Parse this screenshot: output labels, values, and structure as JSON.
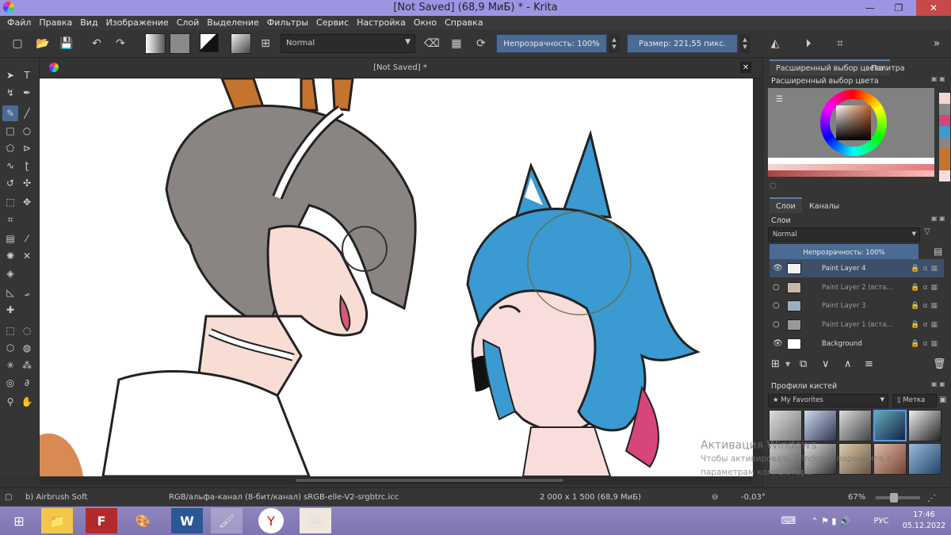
{
  "window": {
    "title": "[Not Saved]  (68,9 МиБ)  * - Krita"
  },
  "menu": [
    "Файл",
    "Правка",
    "Вид",
    "Изображение",
    "Слой",
    "Выделение",
    "Фильтры",
    "Сервис",
    "Настройка",
    "Окно",
    "Справка"
  ],
  "toolbar": {
    "blend_mode": "Normal",
    "opacity_label": "Непрозрачность: 100%",
    "size_label": "Размер: 221,55 пикс."
  },
  "canvas": {
    "tab_title": "[Not Saved]  *"
  },
  "docker": {
    "color_tabs": [
      "Расширенный выбор цвета",
      "Палитра"
    ],
    "color_panel_title": "Расширенный выбор цвета",
    "layer_tabs": [
      "Слои",
      "Каналы"
    ],
    "layers_title": "Слои",
    "layers_blend": "Normal",
    "layers_opacity": "Непрозрачность:  100%",
    "layers": [
      {
        "name": "Paint Layer 4",
        "visible": true,
        "selected": true
      },
      {
        "name": "Paint Layer 2 (вста...",
        "visible": false,
        "selected": false
      },
      {
        "name": "Paint Layer 3",
        "visible": false,
        "selected": false
      },
      {
        "name": "Paint Layer 1 (вста...",
        "visible": false,
        "selected": false
      },
      {
        "name": "Background",
        "visible": true,
        "selected": false
      }
    ],
    "brush_profiles_title": "Профили кистей",
    "brush_tag": "My Favorites",
    "brush_tag_button": "Метка"
  },
  "status": {
    "brush": "b) Airbrush Soft",
    "color_space": "RGB/альфа-канал (8-бит/канал)  sRGB-elle-V2-srgbtrc.icc",
    "dimensions": "2 000 x 1 500 (68,9 МиБ)",
    "rotation": "-0,03°",
    "zoom": "67%"
  },
  "watermark": {
    "line1": "Активация Windows",
    "line2": "Чтобы активировать Windows, перейдите к",
    "line3": "параметрам компьютера."
  },
  "taskbar": {
    "lang": "РУС",
    "time": "17:46",
    "date": "05.12.2022"
  },
  "colors": {
    "accent": "#4b6b95",
    "titlebar": "#9b95e3",
    "hair_blue": "#3a9ad1",
    "hair_grey": "#8a8583"
  }
}
